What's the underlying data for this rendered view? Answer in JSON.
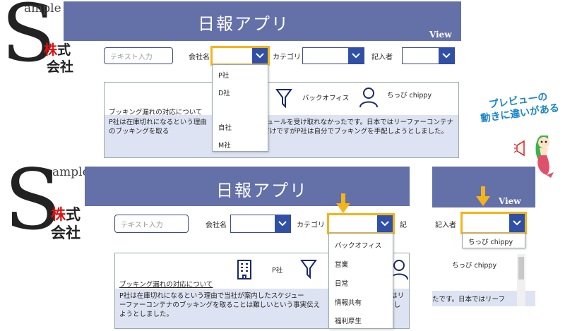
{
  "app": {
    "title": "日報アプリ",
    "view": "View"
  },
  "logo": {
    "s": "S",
    "ample": "ample",
    "line1_red": "株",
    "line1_rest": "式",
    "line2": "会社"
  },
  "search": {
    "placeholder": "テキスト入力"
  },
  "labels": {
    "company": "会社名",
    "category": "カテゴリ",
    "author": "記入者",
    "author_cut": "記"
  },
  "company_options": [
    "P社",
    "D社",
    "自社",
    "M社"
  ],
  "category_options": [
    "バックオフィス",
    "営業",
    "日常",
    "情報共有",
    "福利厚生"
  ],
  "author_options": [
    "ちっぴ chippy"
  ],
  "record": {
    "company": "P社",
    "category": "バックオフィス",
    "author": "ちっぴ chippy",
    "subject": "ブッキング漏れの対応について",
    "body_top": "P社は在庫切れになるという理由　　　　　　スケジュールを受け取れなかったです。日本ではリーファーコンテナのブッキングを取る　　　　　　　　う事実伝えただけですがP社は自分でブッキングを手配しようとしました。",
    "body_bottom": "P社は在庫切れになるという理由で当社が案内したスケジュー　　　　　ったです。日本ではリーファーコンテナのブッキングを取ることは難しいという事実伝え　　　　　　　　は自分しようとしました。",
    "body_right": "たです。日本ではリーフ"
  },
  "callout": {
    "line1": "プレビューの",
    "line2": "動きに違いがある"
  },
  "colors": {
    "header": "#6470a8",
    "accent": "#3050a8",
    "highlight": "#f4b41a",
    "body_bg": "#dde3f2"
  }
}
